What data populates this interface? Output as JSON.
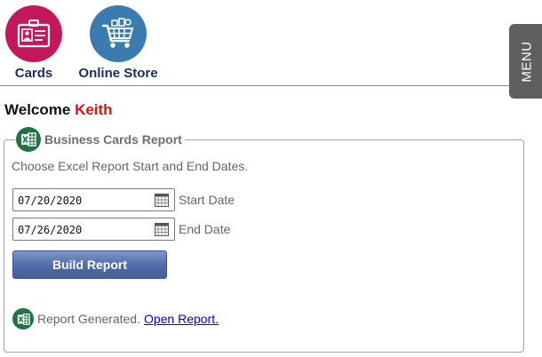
{
  "nav": {
    "items": [
      {
        "label": "Cards",
        "icon": "id-card-icon",
        "color": "#c4185c"
      },
      {
        "label": "Online Store",
        "icon": "shopping-cart-icon",
        "color": "#3a7cb0"
      }
    ],
    "menu_label": "MENU"
  },
  "welcome": {
    "prefix": "Welcome",
    "username": "Keith"
  },
  "report": {
    "title": "Business Cards Report",
    "icon": "excel-icon",
    "instructions": "Choose Excel Report Start and End Dates.",
    "start_date": {
      "value": "07/20/2020",
      "label": "Start Date"
    },
    "end_date": {
      "value": "07/26/2020",
      "label": "End Date"
    },
    "build_label": "Build Report",
    "status_text": "Report Generated.",
    "open_link": "Open Report."
  },
  "colors": {
    "excel_green": "#217346",
    "button_blue": "#4f6ba8",
    "username_red": "#e01010",
    "nav_label": "#1f2b5e"
  }
}
